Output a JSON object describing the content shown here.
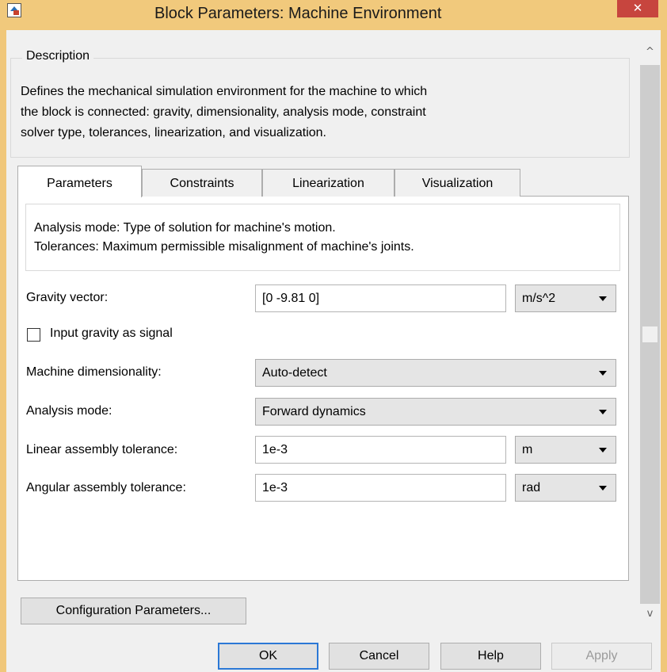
{
  "window": {
    "title": "Block Parameters: Machine Environment",
    "close_glyph": "✕",
    "icon": "simulink-block-icon",
    "close_color": "#c7453e"
  },
  "description": {
    "legend": "Description",
    "lines": [
      "Defines the mechanical simulation environment for the machine to which",
      "the block is connected: gravity, dimensionality, analysis mode, constraint",
      "solver type, tolerances, linearization, and visualization."
    ]
  },
  "tabs": [
    {
      "label": "Parameters",
      "active": true
    },
    {
      "label": "Constraints",
      "active": false
    },
    {
      "label": "Linearization",
      "active": false
    },
    {
      "label": "Visualization",
      "active": false
    }
  ],
  "hint": {
    "lines": [
      "Analysis mode: Type of solution for machine's motion.",
      "Tolerances: Maximum permissible misalignment of machine's joints."
    ]
  },
  "fields": {
    "gravity": {
      "label": "Gravity vector:",
      "value": "[0 -9.81 0]",
      "unit": "m/s^2"
    },
    "gravity_signal": {
      "label": "Input gravity as signal",
      "checked": false
    },
    "dimensionality": {
      "label": "Machine dimensionality:",
      "value": "Auto-detect"
    },
    "analysis_mode": {
      "label": "Analysis mode:",
      "value": "Forward dynamics"
    },
    "linear_tol": {
      "label": "Linear assembly tolerance:",
      "value": "1e-3",
      "unit": "m"
    },
    "angular_tol": {
      "label": "Angular assembly tolerance:",
      "value": "1e-3",
      "unit": "rad"
    }
  },
  "scrollbar": {
    "up": "^",
    "down": "v"
  },
  "buttons": {
    "config": "Configuration Parameters...",
    "ok": "OK",
    "cancel": "Cancel",
    "help": "Help",
    "apply": "Apply"
  }
}
